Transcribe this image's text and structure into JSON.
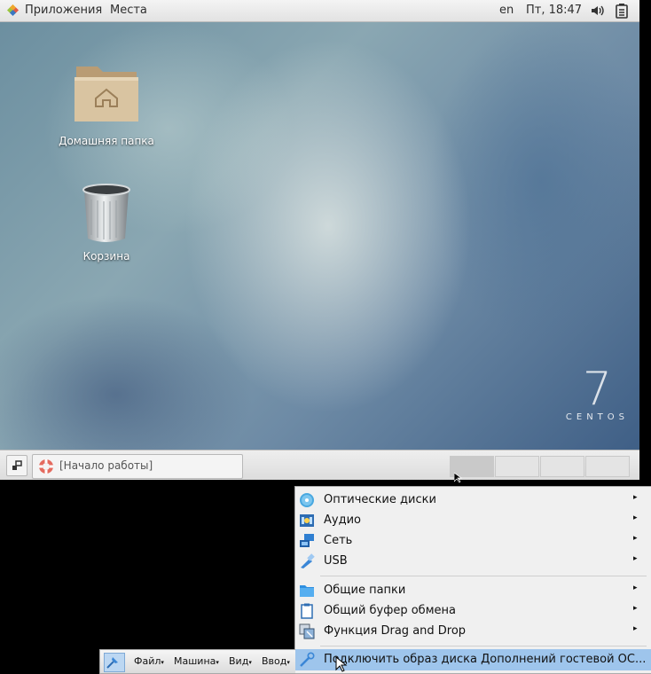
{
  "topbar": {
    "applications": "Приложения",
    "places": "Места",
    "language": "en",
    "clock": "Пт, 18:47",
    "volume_icon": "speaker-icon",
    "battery_icon": "battery-icon"
  },
  "desktop": {
    "icons": [
      {
        "label": "Домашняя папка",
        "icon": "home-folder-icon"
      },
      {
        "label": "Корзина",
        "icon": "trash-icon"
      }
    ],
    "branding": {
      "number": "7",
      "word": "CENTOS"
    }
  },
  "bottombar": {
    "window_list_label": "[Начало работы]",
    "workspaces_count": 4
  },
  "vbox_menu": {
    "items": [
      {
        "label": "Оптические диски",
        "icon": "optical-disc-icon",
        "submenu": true
      },
      {
        "label": "Аудио",
        "icon": "audio-icon",
        "submenu": true
      },
      {
        "label": "Сеть",
        "icon": "network-icon",
        "submenu": true
      },
      {
        "label": "USB",
        "icon": "usb-icon",
        "submenu": true
      },
      {
        "label": "Общие папки",
        "icon": "shared-folder-icon",
        "submenu": true
      },
      {
        "label": "Общий буфер обмена",
        "icon": "clipboard-icon",
        "submenu": true
      },
      {
        "label": "Функция Drag and Drop",
        "icon": "drag-drop-icon",
        "submenu": true
      },
      {
        "label": "Подключить образ диска Дополнений гостевой ОС...",
        "icon": "guest-additions-icon",
        "submenu": false,
        "highlighted": true
      }
    ],
    "submenu_arrow": "▸"
  },
  "vbox_toolbar": {
    "pin_icon": "pin-icon",
    "menus": [
      "Файл",
      "Машина",
      "Вид",
      "Ввод"
    ]
  },
  "colors": {
    "menu_highlight": "#9ec5ec",
    "panel_bg": "#e8e8e8"
  }
}
